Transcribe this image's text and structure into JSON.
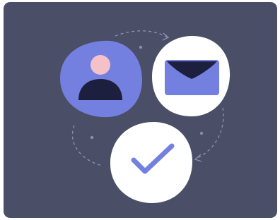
{
  "illustration": {
    "icons": [
      "user-avatar-icon",
      "envelope-icon",
      "checkmark-icon"
    ],
    "colors": {
      "background": "#4A4E67",
      "accent": "#7480E0",
      "dark": "#1D1F3E",
      "skin": "#F5C1C9",
      "bubble": "#FFFFFF",
      "dashes": "#8A8FAE"
    }
  }
}
